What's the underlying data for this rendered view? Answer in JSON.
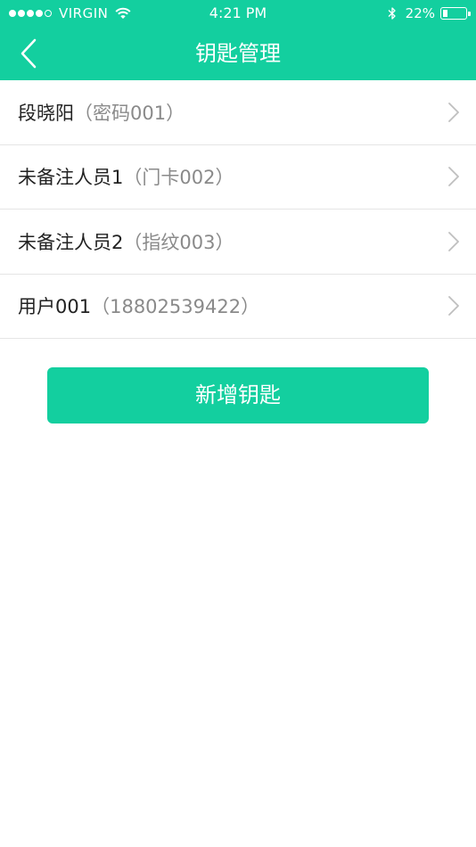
{
  "status_bar": {
    "carrier": "VIRGIN",
    "time": "4:21 PM",
    "battery_percent_text": "22%",
    "battery_level": 0.22
  },
  "nav": {
    "title": "钥匙管理",
    "back_icon": "chevron-left-icon"
  },
  "keys": [
    {
      "name": "段晓阳",
      "detail": "（密码001）"
    },
    {
      "name": "未备注人员1",
      "detail": "（门卡002）"
    },
    {
      "name": "未备注人员2",
      "detail": "（指纹003）"
    },
    {
      "name": "用户001",
      "detail": "（18802539422）"
    }
  ],
  "add_button": {
    "label": "新增钥匙"
  },
  "colors": {
    "accent": "#13cf9f",
    "text_primary": "#222222",
    "text_secondary": "#8a8a8a",
    "divider": "#e5e5e5"
  }
}
